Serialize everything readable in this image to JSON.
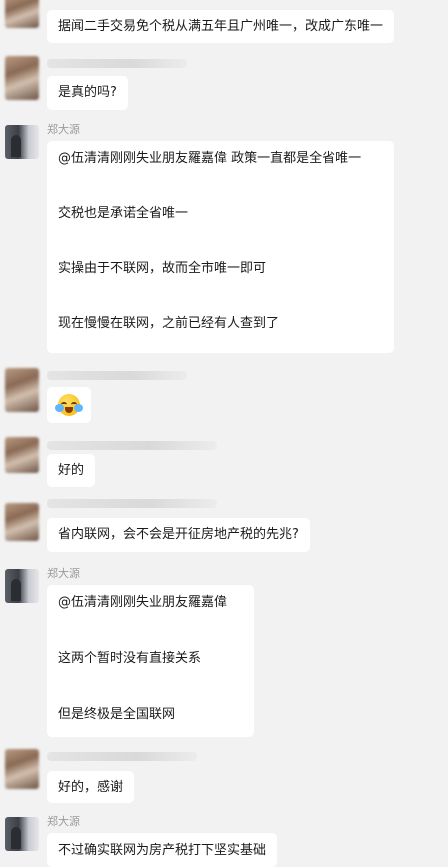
{
  "messages": [
    {
      "id": "m1",
      "text": "据闻二手交易免个税从满五年且广州唯一，改成广东唯一"
    },
    {
      "id": "m2",
      "text": "是真的吗?"
    },
    {
      "id": "m3",
      "sender": "郑大源",
      "lines": [
        "@伍清清刚刚失业朋友羅嘉偉 政策一直都是全省唯一",
        "交税也是承诺全省唯一",
        "实操由于不联网，故而全市唯一即可",
        "现在慢慢在联网，之前已经有人查到了"
      ]
    },
    {
      "id": "m4",
      "emoji": "crying-laughing-emoji"
    },
    {
      "id": "m5",
      "text": "好的"
    },
    {
      "id": "m6",
      "text": "省内联网，会不会是开征房地产税的先兆?"
    },
    {
      "id": "m7",
      "sender": "郑大源",
      "lines": [
        "@伍清清刚刚失业朋友羅嘉偉",
        "这两个暂时没有直接关系",
        "但是终极是全国联网"
      ]
    },
    {
      "id": "m8",
      "text": "好的，感谢"
    },
    {
      "id": "m9",
      "sender": "郑大源",
      "text": "不过确实联网为房产税打下坚实基础"
    }
  ],
  "colors": {
    "background": "#f2f2f2",
    "bubble": "#ffffff",
    "sender": "#9a9a9a"
  }
}
